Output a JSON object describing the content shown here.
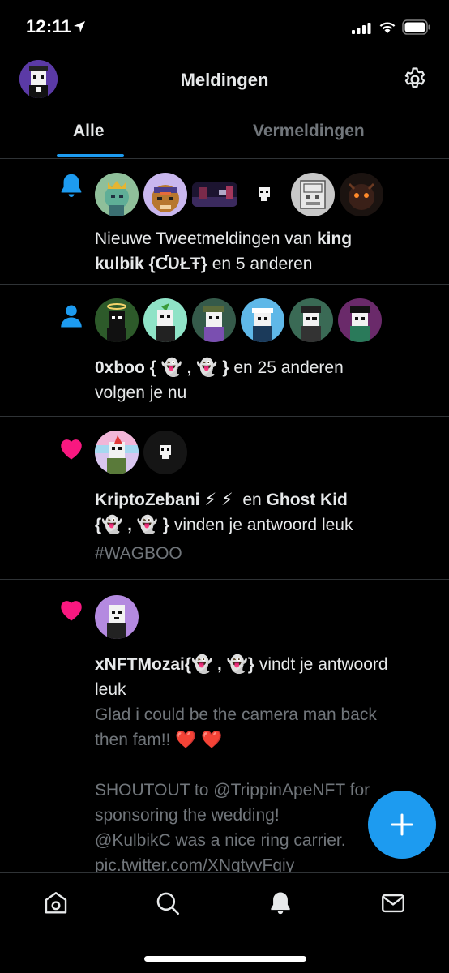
{
  "status_bar": {
    "time": "12:11"
  },
  "header": {
    "title": "Meldingen"
  },
  "tabs": [
    {
      "label": "Alle",
      "active": true
    },
    {
      "label": "Vermeldingen",
      "active": false
    }
  ],
  "notifications": [
    {
      "type": "bell",
      "icon": "bell-icon",
      "line1_prefix": "Nieuwe Tweetmeldingen van ",
      "line1_bold": "king",
      "line2_bold": "kulbik {ƇƲŁŦ}",
      "line2_suffix": " en 5 anderen"
    },
    {
      "type": "follow",
      "icon": "person-icon",
      "line1_bold": "0xboo { 👻 , 👻 }",
      "line1_suffix": " en 25 anderen",
      "line2": "volgen je nu"
    },
    {
      "type": "like",
      "icon": "heart-icon",
      "line1_bold_a": "KriptoZebani ⚡ ⚡",
      "line1_mid": "  en ",
      "line1_bold_b": "Ghost Kid",
      "line2_bold": "{👻 , 👻 }",
      "line2_suffix": " vinden je antwoord leuk",
      "line3": "#WAGBOO"
    },
    {
      "type": "like",
      "icon": "heart-icon",
      "line1_bold": "xNFTMozai{👻 , 👻}",
      "line1_suffix": " vindt je antwoord",
      "line2": "leuk",
      "body": "Glad i could be the camera man back\nthen fam!! ❤️ ❤️\n\nSHOUTOUT to @TrippinApeNFT for\nsponsoring the wedding!\n@KulbikC was a nice ring carrier.\npic.twitter.com/XNgtyvFqiy"
    }
  ],
  "colors": {
    "accent": "#1d9bf0",
    "like": "#f91880",
    "muted": "#71767b",
    "divider": "#2f3336"
  },
  "bottom_nav": [
    "home-icon",
    "search-icon",
    "notifications-icon",
    "messages-icon"
  ]
}
